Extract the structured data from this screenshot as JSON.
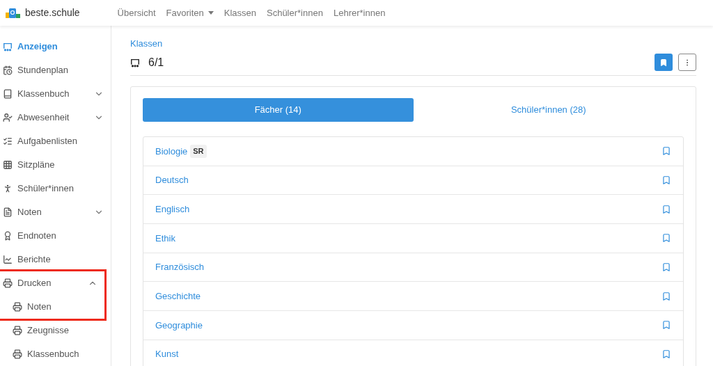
{
  "brand": {
    "name": "beste.schule"
  },
  "nav": [
    {
      "label": "Übersicht",
      "dropdown": false
    },
    {
      "label": "Favoriten",
      "dropdown": true
    },
    {
      "label": "Klassen",
      "dropdown": false
    },
    {
      "label": "Schüler*innen",
      "dropdown": false
    },
    {
      "label": "Lehrer*innen",
      "dropdown": false
    }
  ],
  "sidebar": {
    "items": [
      {
        "label": "Anzeigen",
        "selected": true,
        "highlighted": false
      },
      {
        "label": "Stundenplan",
        "selected": false,
        "highlighted": false
      },
      {
        "label": "Klassenbuch",
        "selected": false,
        "highlighted": false,
        "expanded": false
      },
      {
        "label": "Abwesenheit",
        "selected": false,
        "highlighted": false,
        "expanded": false
      },
      {
        "label": "Aufgabenlisten",
        "selected": false,
        "highlighted": false
      },
      {
        "label": "Sitzpläne",
        "selected": false,
        "highlighted": false
      },
      {
        "label": "Schüler*innen",
        "selected": false,
        "highlighted": false
      },
      {
        "label": "Noten",
        "selected": false,
        "highlighted": false,
        "expanded": false
      },
      {
        "label": "Endnoten",
        "selected": false,
        "highlighted": false
      },
      {
        "label": "Berichte",
        "selected": false,
        "highlighted": false
      },
      {
        "label": "Drucken",
        "selected": false,
        "highlighted": true,
        "expanded": true,
        "children": [
          {
            "label": "Noten",
            "selected": false,
            "highlighted": true
          },
          {
            "label": "Zeugnisse",
            "selected": false,
            "highlighted": false
          },
          {
            "label": "Klassenbuch",
            "selected": false,
            "highlighted": false
          }
        ]
      }
    ]
  },
  "header": {
    "breadcrumb": "Klassen",
    "title": "6/1",
    "bookmarked": true
  },
  "tabs": [
    {
      "label": "Fächer (14)",
      "selected": true
    },
    {
      "label": "Schüler*innen (28)",
      "selected": false
    }
  ],
  "subjects": [
    {
      "name": "Biologie",
      "badge": "SR"
    },
    {
      "name": "Deutsch"
    },
    {
      "name": "Englisch"
    },
    {
      "name": "Ethik"
    },
    {
      "name": "Französisch"
    },
    {
      "name": "Geschichte"
    },
    {
      "name": "Geographie"
    },
    {
      "name": "Kunst"
    }
  ]
}
